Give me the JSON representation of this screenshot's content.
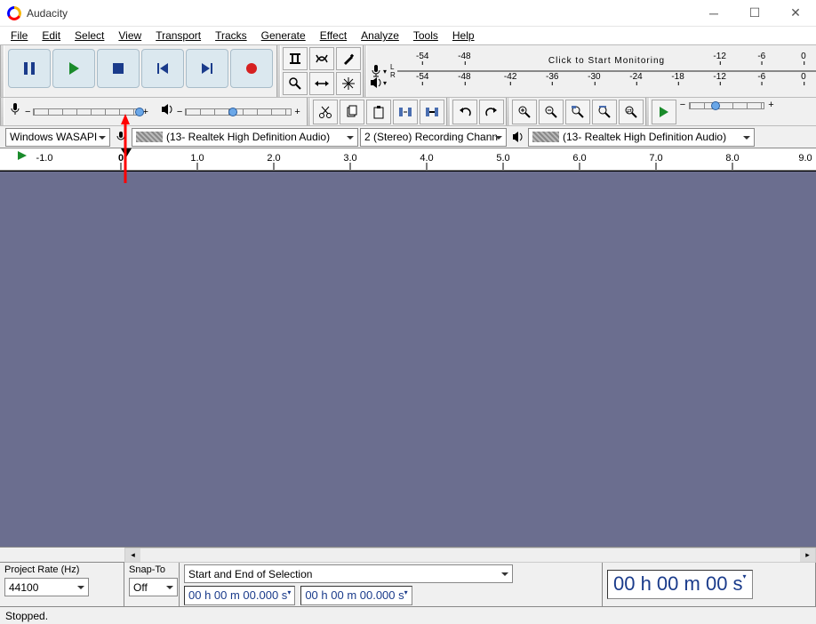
{
  "window": {
    "title": "Audacity"
  },
  "menus": [
    "File",
    "Edit",
    "Select",
    "View",
    "Transport",
    "Tracks",
    "Generate",
    "Effect",
    "Analyze",
    "Tools",
    "Help"
  ],
  "rec_scale": [
    "-54",
    "-48",
    "-42",
    "-36",
    "-30",
    "-24",
    "-18",
    "-12",
    "-6",
    "0"
  ],
  "rec_overlay": "Click to Start Monitoring",
  "play_scale": [
    "-54",
    "-48",
    "-42",
    "-36",
    "-30",
    "-24",
    "-18",
    "-12",
    "-6",
    "0"
  ],
  "devices": {
    "host_label": "Windows WASAPI",
    "rec_device": "(13- Realtek High Definition Audio)",
    "channels": "2 (Stereo) Recording Chann",
    "play_device": "(13- Realtek High Definition Audio)"
  },
  "timeline_marks": [
    "1.0",
    "0",
    "1.0",
    "2.0",
    "3.0",
    "4.0",
    "5.0",
    "6.0",
    "7.0",
    "8.0",
    "9.0"
  ],
  "selection": {
    "project_rate_label": "Project Rate (Hz)",
    "project_rate": "44100",
    "snap_label": "Snap-To",
    "snap_value": "Off",
    "mode_label": "Start and End of Selection",
    "t1": "00 h 00 m 00.000 s",
    "t2": "00 h 00 m 00.000 s",
    "big": "00 h 00 m 00 s"
  },
  "status": "Stopped."
}
